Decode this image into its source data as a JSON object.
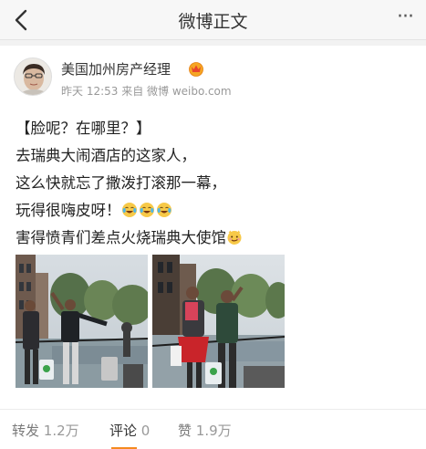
{
  "navbar": {
    "title": "微博正文",
    "back_icon": "chevron-left-icon",
    "more_label": "···"
  },
  "author": {
    "name": "美国加州房产经理",
    "badge_icon": "vip-crown-icon",
    "badge_color": "#f0a020"
  },
  "meta": {
    "time": "昨天 12:53",
    "source": "来自 微博 weibo.com"
  },
  "content": {
    "line1": "【脸呢？在哪里？】",
    "line2": "去瑞典大闹酒店的这家人，",
    "line3": "这么快就忘了撒泼打滚那一幕，",
    "line4": "玩得很嗨皮呀！",
    "line5": "害得愤青们差点火烧瑞典大使馆",
    "emojis": [
      "laugh-cry-emoji",
      "laugh-cry-emoji",
      "laugh-cry-emoji",
      "smirk-emoji"
    ]
  },
  "photos": [
    {
      "alt": "canal-street-photo-1"
    },
    {
      "alt": "canal-street-photo-2"
    }
  ],
  "actions": {
    "repost_label": "转发",
    "repost_count": "1.2万",
    "comment_label": "评论",
    "comment_count": "0",
    "like_label": "赞",
    "like_count": "1.9万",
    "active_tab": "comment",
    "accent_color": "#f58a1f"
  }
}
